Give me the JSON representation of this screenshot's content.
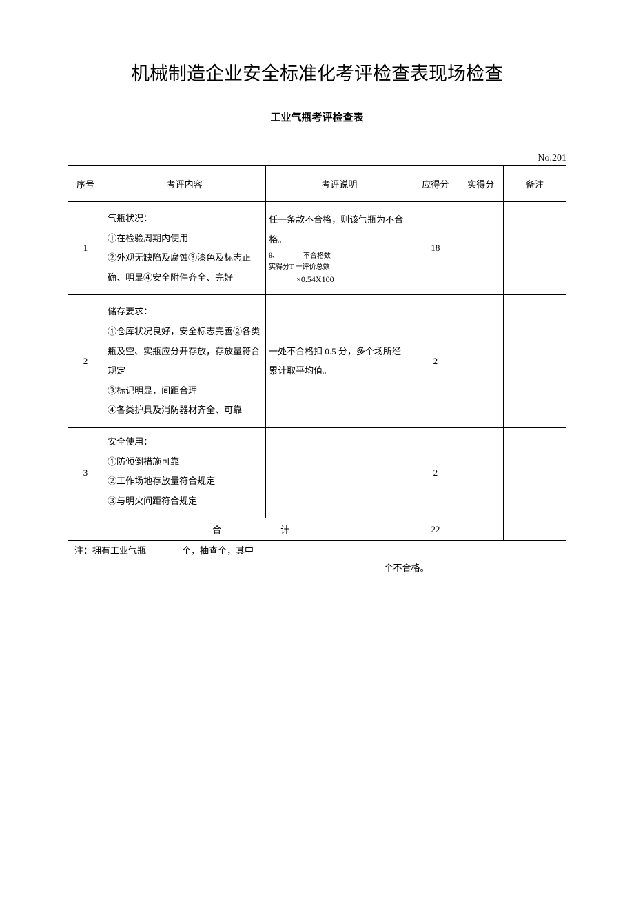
{
  "title": "机械制造企业安全标准化考评检查表现场检查",
  "subtitle": "工业气瓶考评检查表",
  "table_number": "No.201",
  "headers": {
    "seq": "序号",
    "content": "考评内容",
    "desc": "考评说明",
    "score_due": "应得分",
    "score_actual": "实得分",
    "remark": "备注"
  },
  "rows": [
    {
      "seq": "1",
      "content": "气瓶状况：\n①在检验周期内使用\n②外观无缺陷及腐蚀③漆色及标志正确、明显④安全附件齐全、完好",
      "desc_main": "任一条款不合格，则该气瓶为不合格。",
      "desc_formula_top": "θ、　　　　不合格数",
      "desc_formula_mid": "实得分T 一评价总数",
      "desc_formula_bot": "×0.54X100",
      "score_due": "18",
      "score_actual": "",
      "remark": ""
    },
    {
      "seq": "2",
      "content": "储存要求：\n①仓库状况良好，安全标志完善②各类瓶及空、实瓶应分开存放，存放量符合规定\n③标记明显，间距合理\n④各类护具及消防器材齐全、可靠",
      "desc": "一处不合格扣 0.5 分，多个场所经累计取平均值。",
      "score_due": "2",
      "score_actual": "",
      "remark": ""
    },
    {
      "seq": "3",
      "content": "安全使用：\n①防倾倒措施可靠\n②工作场地存放量符合规定\n③与明火间距符合规定",
      "desc": "",
      "score_due": "2",
      "score_actual": "",
      "remark": ""
    }
  ],
  "total": {
    "label": "合　　计",
    "score_due": "22",
    "score_actual": "",
    "remark": ""
  },
  "note_line1": "注：拥有工业气瓶　　　　个，抽查个，其中",
  "note_line2": "个不合格。"
}
